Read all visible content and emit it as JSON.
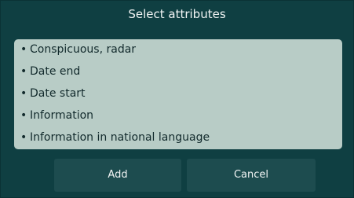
{
  "dialog": {
    "title": "Select attributes",
    "attributes": [
      "Conspicuous, radar",
      "Date end",
      "Date start",
      "Information",
      "Information in national language"
    ],
    "buttons": {
      "add_label": "Add",
      "cancel_label": "Cancel"
    }
  },
  "colors": {
    "dialog_background": "#0f3f42",
    "list_background": "#b8ccc6",
    "button_background": "#1d4c4f",
    "title_text": "#f2f5f5",
    "list_text": "#122a2c"
  }
}
